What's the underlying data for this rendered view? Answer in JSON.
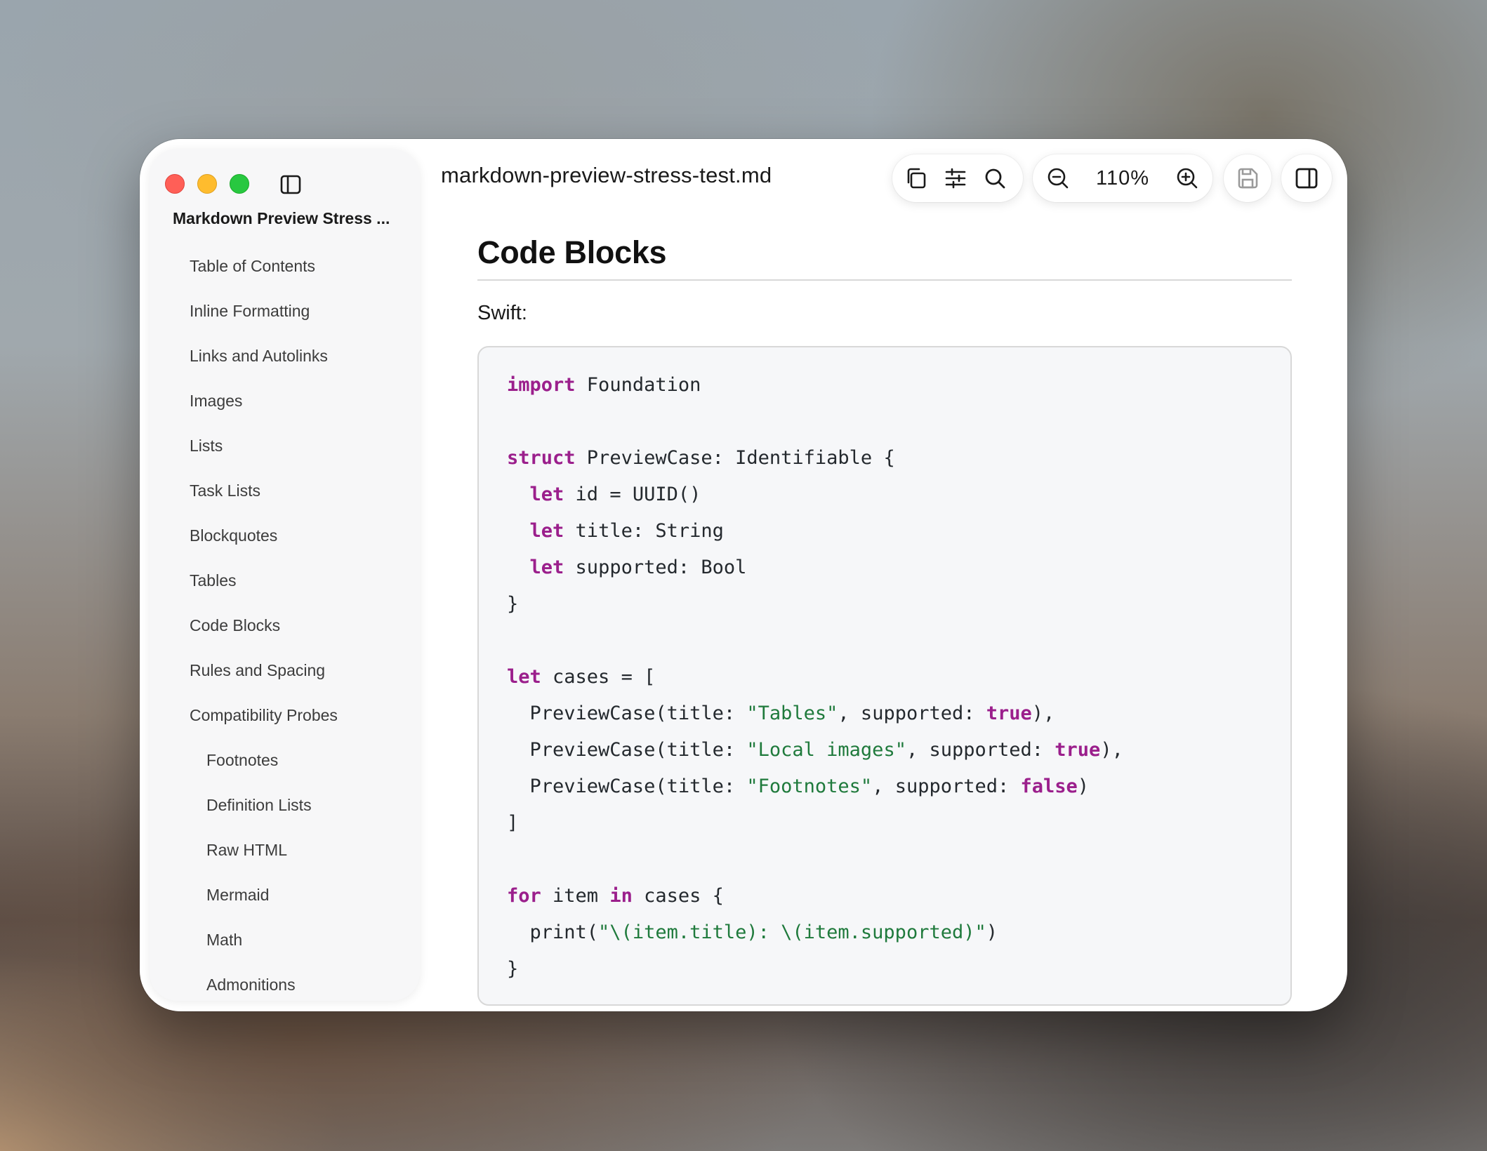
{
  "window": {
    "document_title": "Markdown Preview Stress ...",
    "file_name": "markdown-preview-stress-test.md"
  },
  "toolbar": {
    "zoom_level": "110%",
    "icons": [
      "copy-icon",
      "settings-sliders-icon",
      "search-icon",
      "zoom-out-icon",
      "zoom-in-icon",
      "save-icon",
      "panel-toggle-icon"
    ]
  },
  "sidebar": {
    "items": [
      {
        "label": "Table of Contents",
        "level": 1
      },
      {
        "label": "Inline Formatting",
        "level": 1
      },
      {
        "label": "Links and Autolinks",
        "level": 1
      },
      {
        "label": "Images",
        "level": 1
      },
      {
        "label": "Lists",
        "level": 1
      },
      {
        "label": "Task Lists",
        "level": 1
      },
      {
        "label": "Blockquotes",
        "level": 1
      },
      {
        "label": "Tables",
        "level": 1
      },
      {
        "label": "Code Blocks",
        "level": 1
      },
      {
        "label": "Rules and Spacing",
        "level": 1
      },
      {
        "label": "Compatibility Probes",
        "level": 1
      },
      {
        "label": "Footnotes",
        "level": 2
      },
      {
        "label": "Definition Lists",
        "level": 2
      },
      {
        "label": "Raw HTML",
        "level": 2
      },
      {
        "label": "Mermaid",
        "level": 2
      },
      {
        "label": "Math",
        "level": 2
      },
      {
        "label": "Admonitions",
        "level": 2
      }
    ]
  },
  "content": {
    "heading": "Code Blocks",
    "language_label": "Swift:",
    "code_lines": [
      [
        {
          "t": "import",
          "c": "kw"
        },
        {
          "t": " Foundation"
        }
      ],
      [],
      [
        {
          "t": "struct",
          "c": "kw"
        },
        {
          "t": " PreviewCase: Identifiable {"
        }
      ],
      [
        {
          "t": "  "
        },
        {
          "t": "let",
          "c": "kw"
        },
        {
          "t": " id = UUID()"
        }
      ],
      [
        {
          "t": "  "
        },
        {
          "t": "let",
          "c": "kw"
        },
        {
          "t": " title: String"
        }
      ],
      [
        {
          "t": "  "
        },
        {
          "t": "let",
          "c": "kw"
        },
        {
          "t": " supported: Bool"
        }
      ],
      [
        {
          "t": "}"
        }
      ],
      [],
      [
        {
          "t": "let",
          "c": "kw"
        },
        {
          "t": " cases = ["
        }
      ],
      [
        {
          "t": "  PreviewCase(title: "
        },
        {
          "t": "\"Tables\"",
          "c": "str"
        },
        {
          "t": ", supported: "
        },
        {
          "t": "true",
          "c": "kw"
        },
        {
          "t": "),"
        }
      ],
      [
        {
          "t": "  PreviewCase(title: "
        },
        {
          "t": "\"Local images\"",
          "c": "str"
        },
        {
          "t": ", supported: "
        },
        {
          "t": "true",
          "c": "kw"
        },
        {
          "t": "),"
        }
      ],
      [
        {
          "t": "  PreviewCase(title: "
        },
        {
          "t": "\"Footnotes\"",
          "c": "str"
        },
        {
          "t": ", supported: "
        },
        {
          "t": "false",
          "c": "kw"
        },
        {
          "t": ")"
        }
      ],
      [
        {
          "t": "]"
        }
      ],
      [],
      [
        {
          "t": "for",
          "c": "kw"
        },
        {
          "t": " item "
        },
        {
          "t": "in",
          "c": "kw"
        },
        {
          "t": " cases {"
        }
      ],
      [
        {
          "t": "  print("
        },
        {
          "t": "\"\\(item.title): \\(item.supported)\"",
          "c": "str"
        },
        {
          "t": ")"
        }
      ],
      [
        {
          "t": "}"
        }
      ]
    ]
  },
  "colors": {
    "keyword": "#9b1f8c",
    "string": "#1f7a3c",
    "traffic_red": "#ff5f57",
    "traffic_yellow": "#febc2e",
    "traffic_green": "#28c840"
  }
}
